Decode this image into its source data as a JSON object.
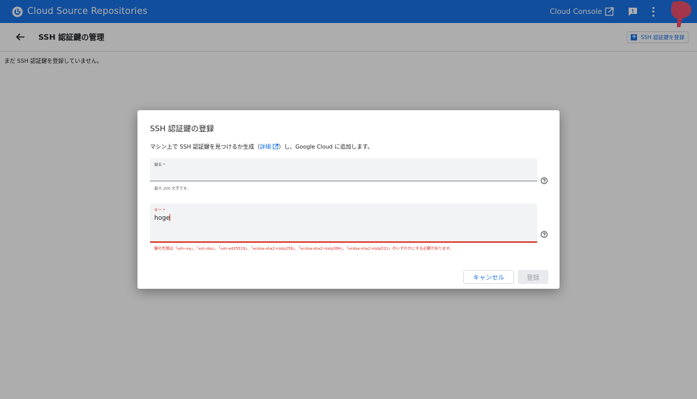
{
  "header": {
    "app_title": "Cloud Source Repositories",
    "console_link": "Cloud Console",
    "logo_icon": "cloud-source-repositories-logo",
    "feedback_icon": "feedback-icon",
    "menu_icon": "more-vert-icon",
    "avatar_icon": "avatar",
    "bar_color": "#1a73e8"
  },
  "subheader": {
    "back_icon": "arrow-back-icon",
    "title": "SSH 認証鍵の管理",
    "register_label": "SSH 認証鍵を登録"
  },
  "main": {
    "empty_message": "まだ SSH 認証鍵を登録していません。"
  },
  "dialog": {
    "title": "SSH 認証鍵の登録",
    "description_prefix": "マシン上で SSH 認証鍵を見つけるか生成（",
    "description_link": "詳細",
    "description_suffix": "）し、Google Cloud に追加します。",
    "name_field": {
      "label": "鍵名 *",
      "value": "",
      "hint": "最大 200 文字です。"
    },
    "key_field": {
      "label": "キー *",
      "value": "hoge",
      "error": "鍵の先頭は「ssh-rsa」、「ssh-dss」、「ssh-ed25519」、「ecdsa-sha2-nistp256」、「ecdsa-sha2-nistp384」、「ecdsa-sha2-nistp521」のいずれかにする必要があります。"
    },
    "cancel_label": "キャンセル",
    "submit_label": "登録",
    "error_color": "#d93025"
  }
}
